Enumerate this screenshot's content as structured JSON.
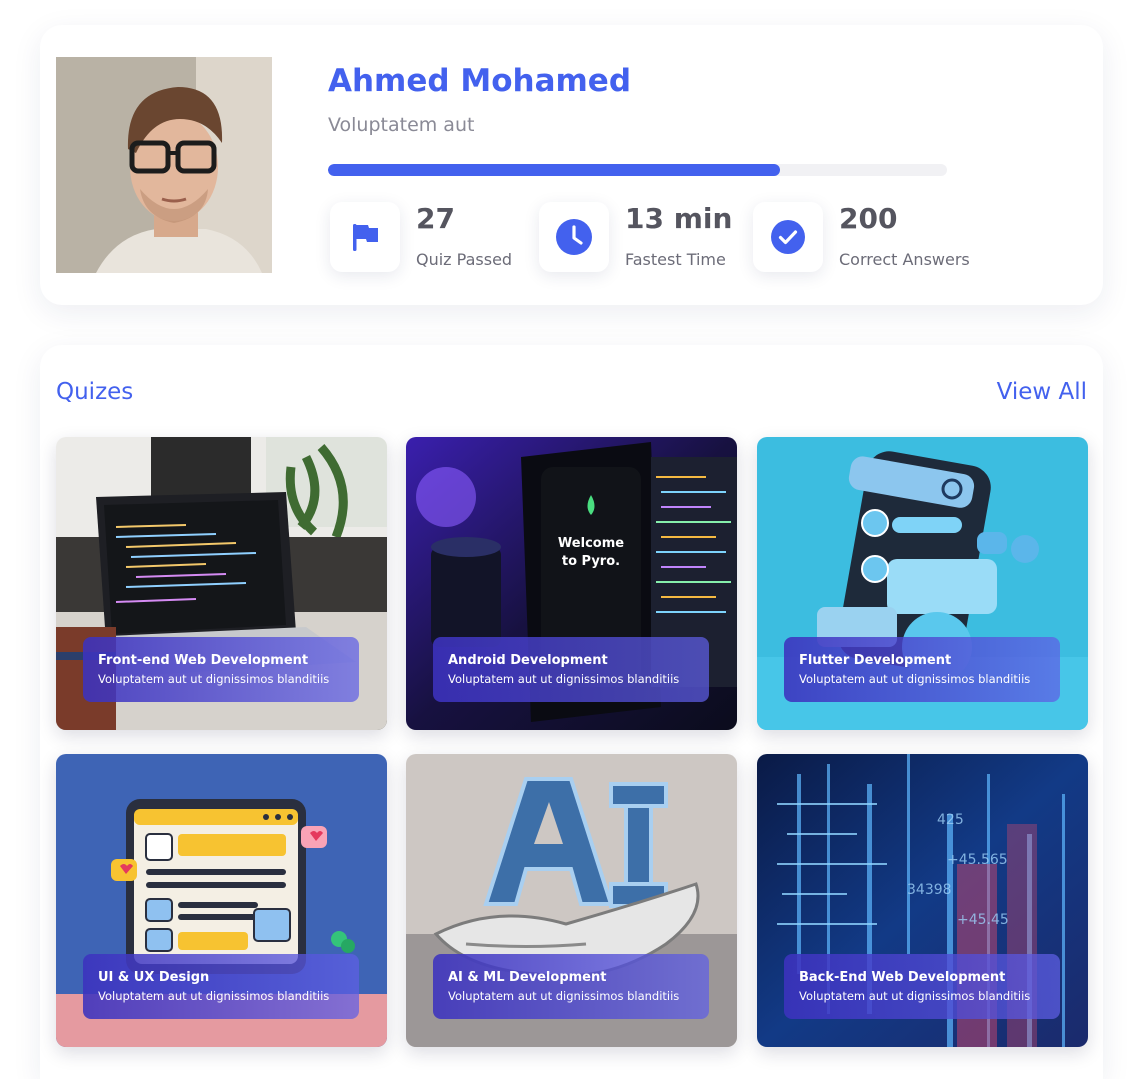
{
  "profile": {
    "name": "Ahmed Mohamed",
    "subtitle": "Voluptatem aut",
    "progress_percent": 73,
    "stats": [
      {
        "icon": "flag-icon",
        "value": "27",
        "label": "Quiz Passed"
      },
      {
        "icon": "clock-icon",
        "value": "13 min",
        "label": "Fastest Time"
      },
      {
        "icon": "check-circle-icon",
        "value": "200",
        "label": "Correct Answers"
      }
    ]
  },
  "quizzes": {
    "title": "Quizes",
    "view_all": "View All",
    "items": [
      {
        "title": "Front-end Web Development",
        "subtitle": "Voluptatem aut ut dignissimos blanditiis"
      },
      {
        "title": "Android Development",
        "subtitle": "Voluptatem aut ut dignissimos blanditiis"
      },
      {
        "title": "Flutter Development",
        "subtitle": "Voluptatem aut ut dignissimos blanditiis"
      },
      {
        "title": "UI & UX Design",
        "subtitle": "Voluptatem aut ut dignissimos blanditiis"
      },
      {
        "title": "AI & ML Development",
        "subtitle": "Voluptatem aut ut dignissimos blanditiis"
      },
      {
        "title": "Back-End Web Development",
        "subtitle": "Voluptatem aut ut dignissimos blanditiis"
      }
    ]
  },
  "colors": {
    "accent": "#4361ee",
    "caption_gradient_start": "#3c32be",
    "caption_gradient_end": "#5f5fe6"
  }
}
